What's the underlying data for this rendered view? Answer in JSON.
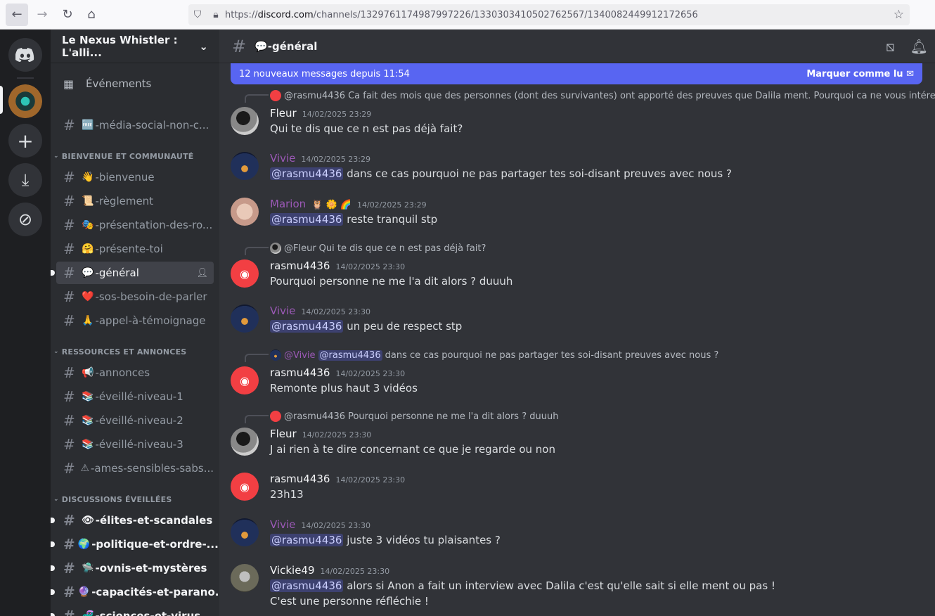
{
  "browser": {
    "url_prefix": "https://",
    "url_domain": "discord.com",
    "url_path": "/channels/1329761174987997226/1330303410502762567/1340082449912172656"
  },
  "server": {
    "name": "Le Nexus Whistler : L'alli..."
  },
  "sidebar": {
    "events_label": "Événements",
    "channels_top": [
      {
        "emoji": "🆓",
        "name": "-média-social-non-c..."
      }
    ],
    "categories": [
      {
        "label": "BIENVENUE ET COMMUNAUTÉ",
        "channels": [
          {
            "emoji": "👋",
            "name": "-bienvenue"
          },
          {
            "emoji": "📜",
            "name": "-règlement"
          },
          {
            "emoji": "🎭",
            "name": "-présentation-des-ro..."
          },
          {
            "emoji": "🤗",
            "name": "-présente-toi"
          },
          {
            "emoji": "💬",
            "name": "-général"
          },
          {
            "emoji": "❤️",
            "name": "-sos-besoin-de-parler"
          },
          {
            "emoji": "🙏",
            "name": "-appel-à-témoignage"
          }
        ]
      },
      {
        "label": "RESSOURCES ET ANNONCES",
        "channels": [
          {
            "emoji": "📢",
            "name": "-annonces"
          },
          {
            "emoji": "📚",
            "name": "-éveillé-niveau-1"
          },
          {
            "emoji": "📚",
            "name": "-éveillé-niveau-2"
          },
          {
            "emoji": "📚",
            "name": "-éveillé-niveau-3"
          },
          {
            "emoji": "⚠",
            "name": "-ames-sensibles-sabs..."
          }
        ]
      },
      {
        "label": "DISCUSSIONS ÉVEILLÉES",
        "channels": [
          {
            "emoji": "👁",
            "name": "-élites-et-scandales"
          },
          {
            "emoji": "🌍",
            "name": "-politique-et-ordre-..."
          },
          {
            "emoji": "🛸",
            "name": "-ovnis-et-mystères"
          },
          {
            "emoji": "🔮",
            "name": "-capacités-et-parano..."
          },
          {
            "emoji": "🧬",
            "name": "-sciences-et-virus"
          }
        ]
      }
    ]
  },
  "chat": {
    "channel_emoji": "💬",
    "channel_name": "-général",
    "banner_text": "12 nouveaux messages depuis 11:54",
    "banner_action": "Marquer comme lu",
    "messages": [
      {
        "reply_name": "@rasmu4436",
        "reply_text": "Ca fait des mois que des personnes (dont des survivantes) ont apporté des preuves que Dalila ment. Pourquoi ca ne vous intéresse ...",
        "author": "Fleur",
        "time": "14/02/2025 23:29",
        "text": "Qui te dis que ce n est pas déjà fait?"
      },
      {
        "author": "Vivie",
        "time": "14/02/2025 23:29",
        "mention": "@rasmu4436",
        "text": " dans ce cas pourquoi ne pas partager tes soi-disant preuves avec nous ?"
      },
      {
        "author": "Marion",
        "author_emoji": "🦉 🌼 🌈",
        "time": "14/02/2025 23:29",
        "mention": "@rasmu4436",
        "text": " reste tranquil stp"
      },
      {
        "reply_name": "@Fleur",
        "reply_text": "Qui te dis que ce n est pas déjà fait?",
        "author": "rasmu4436",
        "time": "14/02/2025 23:30",
        "text": "Pourquoi personne ne me l'a dit alors ? duuuh"
      },
      {
        "author": "Vivie",
        "time": "14/02/2025 23:30",
        "mention": "@rasmu4436",
        "text": " un peu de respect stp"
      },
      {
        "reply_name": "@Vivie",
        "reply_mention": "@rasmu4436",
        "reply_text": "dans ce cas pourquoi ne pas partager tes soi-disant preuves avec nous ?",
        "author": "rasmu4436",
        "time": "14/02/2025 23:30",
        "text": "Remonte plus haut 3 vidéos"
      },
      {
        "reply_name": "@rasmu4436",
        "reply_text": "Pourquoi personne ne me l'a dit alors ? duuuh",
        "author": "Fleur",
        "time": "14/02/2025 23:30",
        "text": "J ai rien à te dire concernant ce que je regarde ou non"
      },
      {
        "author": "rasmu4436",
        "time": "14/02/2025 23:30",
        "text": "23h13"
      },
      {
        "author": "Vivie",
        "time": "14/02/2025 23:30",
        "mention": "@rasmu4436",
        "text": " juste 3 vidéos tu plaisantes ?"
      },
      {
        "author": "Vickie49",
        "time": "14/02/2025 23:30",
        "mention": "@rasmu4436",
        "text": " alors si Anon a fait un interview avec Dalila c'est qu'elle sait si elle ment ou pas !",
        "text2": "C'est une personne réfléchie !"
      }
    ]
  }
}
